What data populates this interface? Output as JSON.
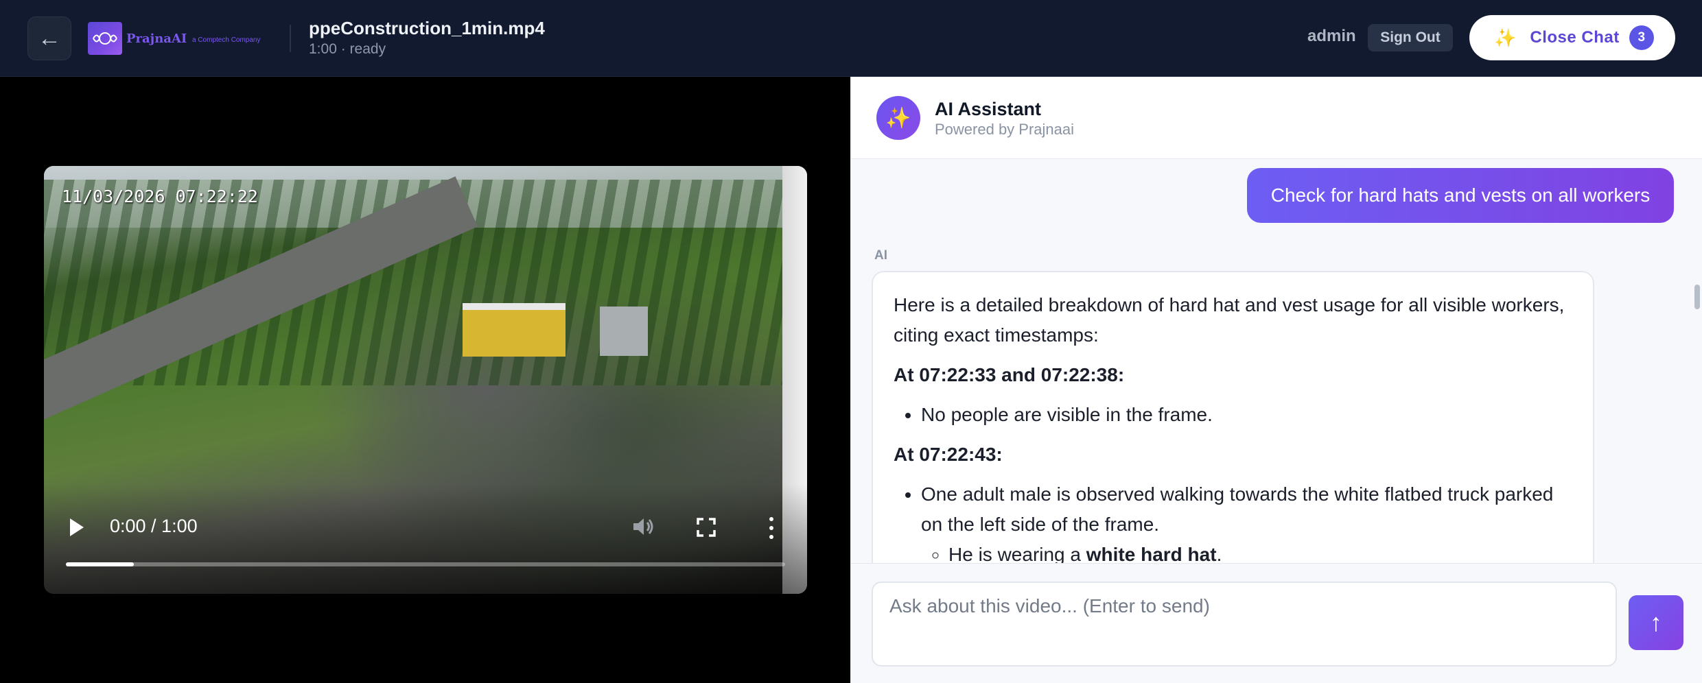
{
  "header": {
    "back_glyph": "←",
    "logo_name": "PrajnaAI",
    "logo_sub": "a Comptech Company",
    "file_name": "ppeConstruction_1min.mp4",
    "file_meta": "1:00 · ready",
    "user": "admin",
    "sign_out": "Sign Out",
    "close_chat": "Close Chat",
    "chat_count": "3",
    "close_chat_icon": "sparkles-icon"
  },
  "video": {
    "timestamp": "11/03/2026 07:22:22",
    "time": "0:00 / 1:00",
    "progress_fraction": 0.094
  },
  "chat": {
    "assistant_name": "AI Assistant",
    "assistant_sub": "Powered by Prajnaai",
    "user_message": "Check for hard hats and vests on all workers",
    "ai_tag": "AI",
    "ai_intro": "Here is a detailed breakdown of hard hat and vest usage for all visible workers, citing exact timestamps:",
    "section1_title": "At 07:22:33 and 07:22:38:",
    "section1_item": "No people are visible in the frame.",
    "section2_title": "At 07:22:43:",
    "section2_item": "One adult male is observed walking towards the white flatbed truck parked on the left side of the frame.",
    "section2_subitem_prefix": "He is wearing a ",
    "section2_subitem_bold": "white hard hat",
    "section2_subitem_suffix": ".",
    "input_placeholder": "Ask about this video... (Enter to send)",
    "send_glyph": "↑"
  },
  "colors": {
    "header_bg": "#111a2e",
    "accent": "#6d5ef3",
    "accent_end": "#8042e2",
    "badge": "#5b55e6"
  }
}
